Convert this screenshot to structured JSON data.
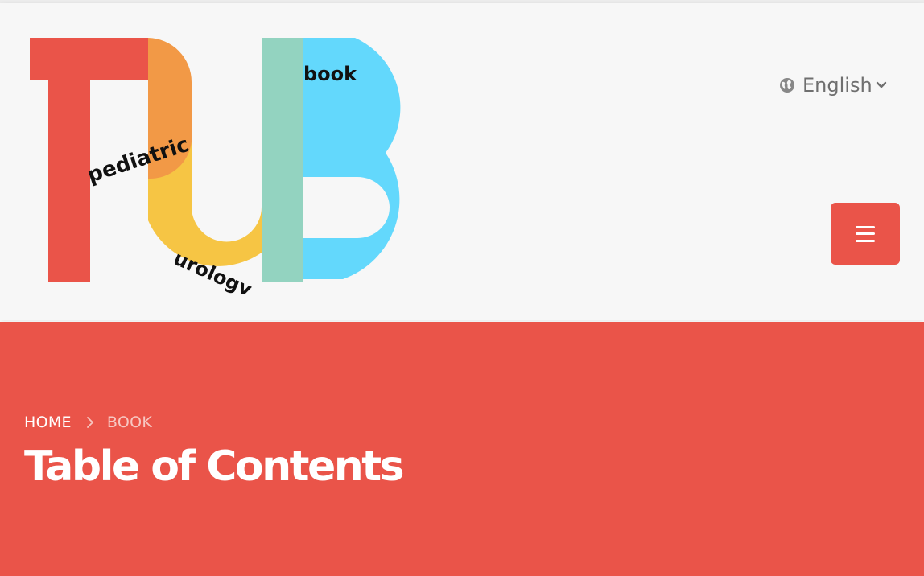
{
  "logo": {
    "words": {
      "pediatric": "pediatric",
      "urology": "urology",
      "book": "book"
    },
    "colors": {
      "p": "#ea5449",
      "orange": "#f29946",
      "yellow": "#f6c544",
      "teal": "#93d3c0",
      "blue": "#63d8fc"
    }
  },
  "language": {
    "icon": "globe-icon",
    "label": "English",
    "dropdown_icon": "chevron-down-icon"
  },
  "menu": {
    "icon": "hamburger-icon",
    "color": "#ea5449"
  },
  "breadcrumb": {
    "home": "HOME",
    "separator_icon": "chevron-right-icon",
    "current": "BOOK"
  },
  "hero": {
    "title": "Table of Contents",
    "background": "#ea5449"
  }
}
